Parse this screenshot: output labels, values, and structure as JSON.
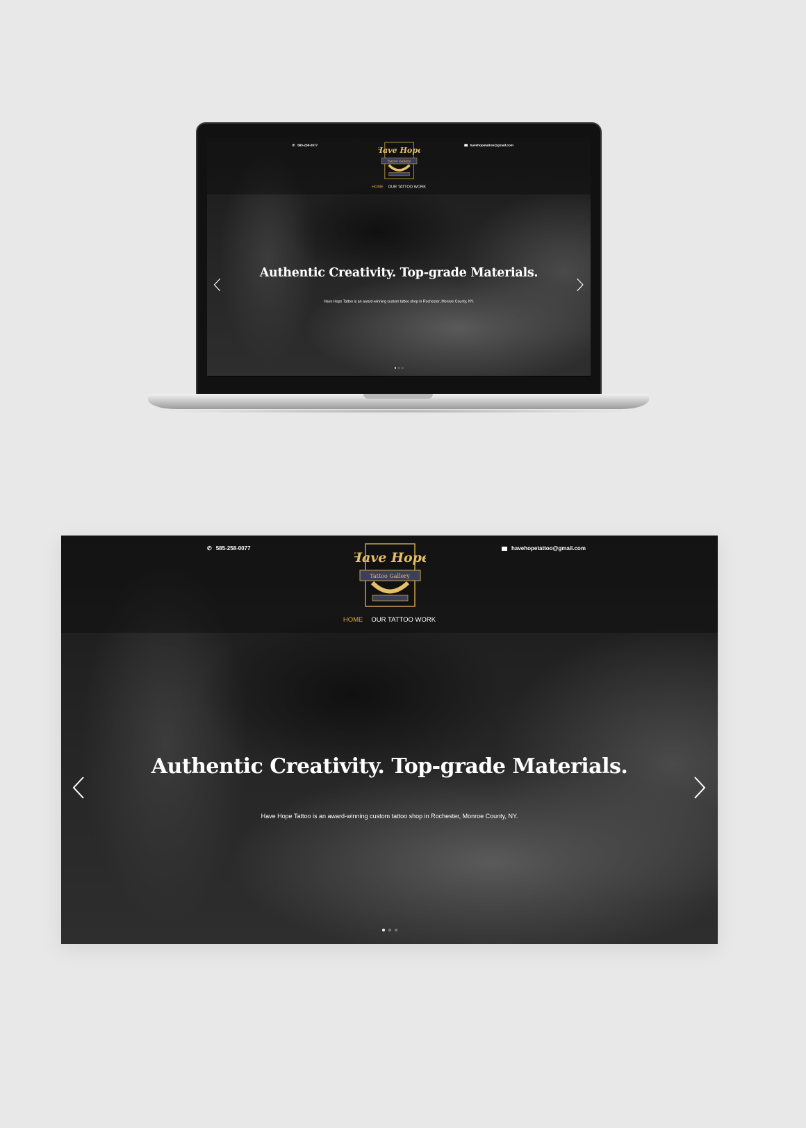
{
  "header": {
    "phone": "585-258-0077",
    "email": "havehopetattoo@gmail.com",
    "logo_text": "Have Hope Tattoo Gallery"
  },
  "nav": {
    "items": [
      {
        "label": "HOME"
      },
      {
        "label": "OUR TATTOO WORK"
      }
    ]
  },
  "hero": {
    "title": "Authentic Creativity. Top-grade Materials.",
    "subtitle": "Have Hope Tattoo is an award-winning custom tattoo shop in Rochester, Monroe County, NY.",
    "slide_count": 3,
    "active_slide": 1
  },
  "colors": {
    "accent": "#d9a94a",
    "background": "#e8e8e8"
  }
}
